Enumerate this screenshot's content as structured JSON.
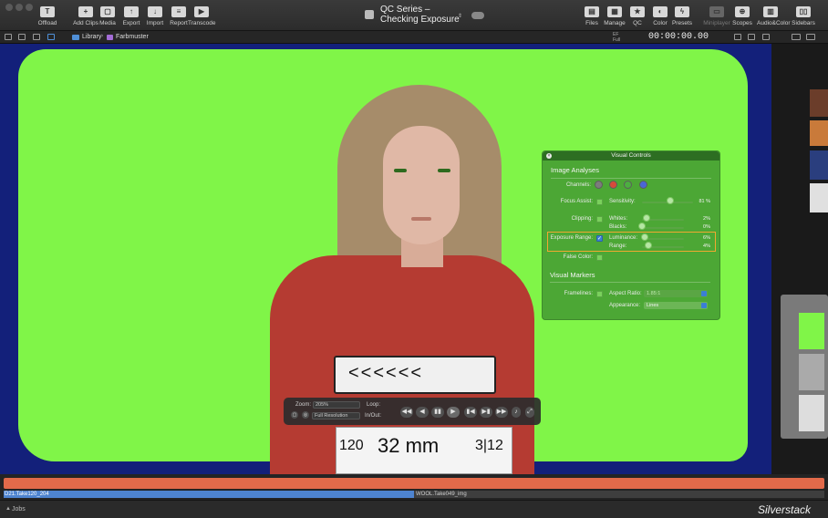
{
  "toolbar": {
    "left_tools": [
      {
        "label": "Offload",
        "icon": "offload-icon"
      },
      {
        "label": "Add Clips",
        "icon": "add-clips-icon"
      },
      {
        "label": "Media",
        "icon": "media-icon"
      },
      {
        "label": "Export",
        "icon": "export-icon"
      },
      {
        "label": "Import",
        "icon": "import-icon"
      },
      {
        "label": "Report",
        "icon": "report-icon"
      },
      {
        "label": "Transcode",
        "icon": "transcode-icon"
      }
    ],
    "title_line1": "QC Series –",
    "title_line2": "Checking Exposure",
    "right_tools": [
      {
        "label": "Files",
        "icon": "files-icon"
      },
      {
        "label": "Manage",
        "icon": "manage-icon"
      },
      {
        "label": "QC",
        "icon": "star-icon"
      },
      {
        "label": "Color",
        "icon": "color-icon"
      },
      {
        "label": "Presets",
        "icon": "presets-icon"
      },
      {
        "label": "Miniplayer",
        "icon": "miniplayer-icon"
      },
      {
        "label": "Scopes",
        "icon": "scopes-icon"
      },
      {
        "label": "Audio&Color",
        "icon": "audio-color-icon"
      },
      {
        "label": "Sidebars",
        "icon": "sidebars-icon"
      }
    ]
  },
  "pathbar": {
    "crumb_library": "Library",
    "separator": "›",
    "crumb_bin": "Farbmuster",
    "tc_aux1": "EF",
    "tc_aux2": "Full",
    "timecode": "00:00:00.00"
  },
  "slate": {
    "marks": "<<<<<<",
    "scene": "120",
    "lens": "32 mm",
    "date": "3|12"
  },
  "hud": {
    "zoom_label": "Zoom:",
    "zoom_value": "205%",
    "loop_label": "Loop:",
    "resolution_value": "Full Resolution",
    "inout_label": "In/Out:",
    "buttons": [
      "◀◀",
      "◀",
      "▮▮",
      "▶",
      "▮◀",
      "▶▮",
      "▶▶"
    ]
  },
  "visual_controls": {
    "title": "Visual Controls",
    "close": "×",
    "section_analyses": "Image Analyses",
    "channels_label": "Channels:",
    "channel_colors": [
      "#7c7c7c",
      "#d64a3a",
      "#4caf40",
      "#4a66d6"
    ],
    "focus_assist_label": "Focus Assist:",
    "sensitivity_label": "Sensitivity:",
    "sensitivity_value": "81 %",
    "sensitivity_level": 0.55,
    "clipping_label": "Clipping:",
    "whites_label": "Whites:",
    "whites_value": "2%",
    "whites_level": 0.1,
    "blacks_label": "Blacks:",
    "blacks_value": "0%",
    "blacks_level": 0.0,
    "exposure_label": "Exposure Range:",
    "exposure_check": "✓",
    "luminance_label": "Luminance:",
    "luminance_value": "6%",
    "luminance_level": 0.06,
    "range_label": "Range:",
    "range_value": "4%",
    "range_level": 0.15,
    "false_color_label": "False Color:",
    "section_markers": "Visual Markers",
    "framelines_label": "Framelines:",
    "aspect_label": "Aspect Ratio:",
    "aspect_value": "1.85:1",
    "appearance_label": "Appearance:",
    "appearance_value": "Lines"
  },
  "timeline": {
    "clip_a": "D21.Take120_204",
    "clip_b": "WOOL.Take049_img"
  },
  "status": {
    "jobs_icon": "▲",
    "jobs": "Jobs",
    "brand": "Silverstack"
  },
  "colors": {
    "keyed_green": "#80f548",
    "panel_green": "#48a034",
    "accent_blue": "#4e84d0",
    "audio_track": "#e26a4a",
    "highlight_orange": "#f0a830"
  }
}
